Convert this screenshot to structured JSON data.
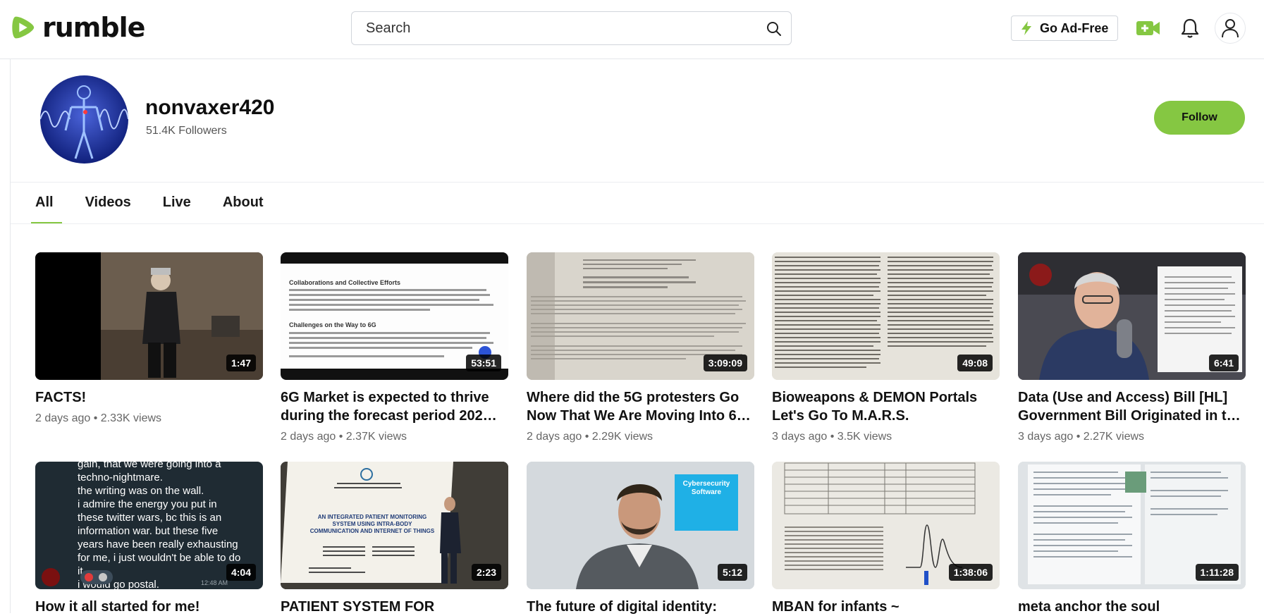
{
  "header": {
    "logo_text": "rumble",
    "search_placeholder": "Search",
    "ad_free_label": "Go Ad-Free",
    "brand_color": "#85c742"
  },
  "channel": {
    "name": "nonvaxer420",
    "followers": "51.4K Followers",
    "follow_label": "Follow"
  },
  "tabs": [
    {
      "label": "All",
      "active": true
    },
    {
      "label": "Videos",
      "active": false
    },
    {
      "label": "Live",
      "active": false
    },
    {
      "label": "About",
      "active": false
    }
  ],
  "videos": [
    {
      "title": "FACTS!",
      "meta": "2 days ago • 2.33K  views",
      "duration": "1:47"
    },
    {
      "title": "6G Market is expected to thrive during the forecast period 202…",
      "meta": "2 days ago • 2.37K  views",
      "duration": "53:51"
    },
    {
      "title": "Where did the 5G protesters Go Now That We Are Moving Into 6…",
      "meta": "2 days ago • 2.29K  views",
      "duration": "3:09:09"
    },
    {
      "title": "Bioweapons & DEMON Portals Let's Go To M.A.R.S.",
      "meta": "3 days ago • 3.5K  views",
      "duration": "49:08"
    },
    {
      "title": "Data (Use and Access) Bill [HL] Government Bill Originated in t…",
      "meta": "3 days ago • 2.27K  views",
      "duration": "6:41"
    },
    {
      "title": "How it all started for me!",
      "meta": "",
      "duration": "4:04"
    },
    {
      "title": "PATIENT SYSTEM FOR",
      "meta": "",
      "duration": "2:23"
    },
    {
      "title": "The future of digital identity:",
      "meta": "",
      "duration": "5:12"
    },
    {
      "title": "MBAN for infants ~",
      "meta": "",
      "duration": "1:38:06"
    },
    {
      "title": "meta anchor the soul",
      "meta": "",
      "duration": "1:11:28"
    }
  ],
  "thumb_text": {
    "t6_lines": [
      "gain, that we were going into a",
      "techno-nightmare.",
      "the writing was on the wall.",
      "i admire the energy you put in",
      "these twitter wars, bc this is an",
      "information war. but these five",
      "years have been really exhausting",
      "for me, i just wouldn't be able to do",
      "it.",
      "i would go postal."
    ],
    "t6_time": "12:48 AM",
    "t7_heading": "AN INTEGRATED PATIENT MONITORING SYSTEM USING INTRA-BODY COMMUNICATION AND INTERNET OF THINGS",
    "t8_label": "Cybersecurity Software",
    "t2_heading1": "Collaborations and Collective Efforts",
    "t2_heading2": "Challenges on the Way to 6G"
  }
}
